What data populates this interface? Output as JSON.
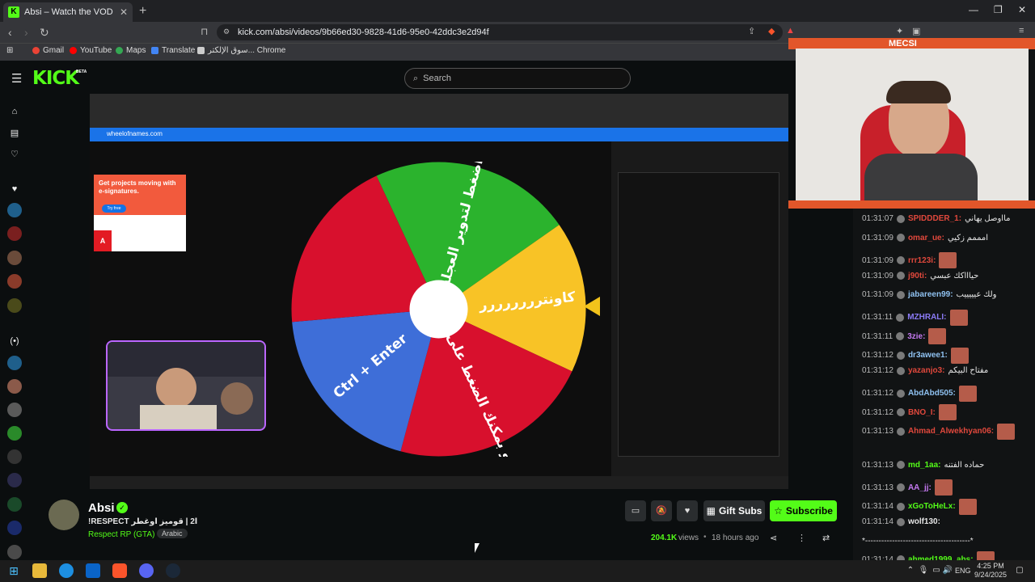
{
  "browser": {
    "tab_title": "Absi – Watch the VOD on Kick",
    "url": "kick.com/absi/videos/9b66ed30-9828-41d6-95e0-42ddc3e2d94f",
    "bookmarks": [
      "Gmail",
      "YouTube",
      "Maps",
      "Translate",
      "سوق الإلكتر... Chrome"
    ],
    "accent": "#53fc18"
  },
  "header": {
    "logo": "KICK",
    "beta": "BETA",
    "search_placeholder": "Search"
  },
  "video": {
    "inner_url": "wheelofnames.com",
    "ad_text": "Get projects moving with e-signatures.",
    "ad_button": "Try free",
    "ad_logo": "Adobe",
    "wheel_segments": [
      {
        "label": "اضغط لتدوير العجلة",
        "color": "#2bb32d"
      },
      {
        "label": "كاونترررررررر",
        "color": "#f8c326"
      },
      {
        "label": "أو بمكنك الضغط على زر",
        "color": "#d8102d"
      },
      {
        "label": "Ctrl + Enter",
        "color": "#3e6ed8"
      },
      {
        "label": "",
        "color": "#d8102d"
      }
    ]
  },
  "channel": {
    "name": "Absi",
    "title": "!RESPECT ا2 | قوميز اوغطر",
    "category": "Respect RP (GTA)",
    "tag": "Arabic",
    "views": "204.1K",
    "views_label": "views",
    "ago": "18 hours ago",
    "gift_subs": "Gift Subs",
    "subscribe": "Subscribe"
  },
  "overlay": {
    "brand": "MECSI"
  },
  "chat": [
    {
      "time": "01:31:07",
      "user": "SPIDDDER_1",
      "color": "#e0483c",
      "msg": "مااوصل يهاني",
      "emote": false
    },
    {
      "time": "01:31:09",
      "user": "omar_ue",
      "color": "#e0483c",
      "msg": "امممم زكيي",
      "emote": false
    },
    {
      "time": "01:31:09",
      "user": "rrr123i",
      "color": "#e0483c",
      "msg": "",
      "emote": true
    },
    {
      "time": "01:31:09",
      "user": "j90ti",
      "color": "#e0483c",
      "msg": "حياااكك عبسي",
      "emote": false
    },
    {
      "time": "01:31:09",
      "user": "jabareen99",
      "color": "#8fc1f0",
      "msg": "ولك عيييييب",
      "emote": false
    },
    {
      "time": "01:31:11",
      "user": "MZHRALI",
      "color": "#8b7bf6",
      "msg": "",
      "emote": true
    },
    {
      "time": "01:31:11",
      "user": "3zie",
      "color": "#c479f0",
      "msg": "",
      "emote": true
    },
    {
      "time": "01:31:12",
      "user": "dr3awee1",
      "color": "#8fc1f0",
      "msg": "",
      "emote": true
    },
    {
      "time": "01:31:12",
      "user": "yazanjo3",
      "color": "#e0483c",
      "msg": "مفتاح البيكم",
      "emote": false
    },
    {
      "time": "01:31:12",
      "user": "AbdAbd505",
      "color": "#8fc1f0",
      "msg": "",
      "emote": true
    },
    {
      "time": "01:31:12",
      "user": "BNO_I",
      "color": "#e0483c",
      "msg": "",
      "emote": true
    },
    {
      "time": "01:31:13",
      "user": "Ahmad_Alwekhyan06",
      "color": "#e0483c",
      "msg": "",
      "emote": true
    },
    {
      "time": "01:31:13",
      "user": "md_1aa",
      "color": "#53fc18",
      "msg": "حماده الفتنه",
      "emote": false
    },
    {
      "time": "01:31:13",
      "user": "AA_jj",
      "color": "#c479f0",
      "msg": "",
      "emote": true
    },
    {
      "time": "01:31:14",
      "user": "xGoToHeLx",
      "color": "#53fc18",
      "msg": "",
      "emote": true
    },
    {
      "time": "01:31:14",
      "user": "wolf130",
      "color": "#e6e6e6",
      "msg": "",
      "emote": false
    },
    {
      "time": "",
      "user": "",
      "color": "#e6e6e6",
      "msg": "*---------------------------------------*",
      "emote": false
    },
    {
      "time": "01:31:14",
      "user": "ahmed1999_abs",
      "color": "#53fc18",
      "msg": "",
      "emote": true
    }
  ],
  "taskbar": {
    "lang": "ENG",
    "time": "4:25 PM",
    "date": "9/24/2025"
  }
}
